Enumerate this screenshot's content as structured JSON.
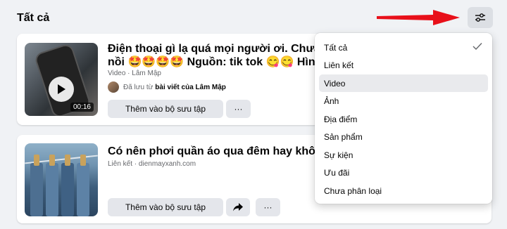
{
  "header": {
    "title": "Tất cả"
  },
  "filter": {
    "icon": "sliders-icon"
  },
  "items": [
    {
      "title_line1": "Điện thoại gì lạ quá mọi người ơi. Chưa thấy",
      "title_line2": "nồi 🤩🤩🤩🤩 Nguồn: tik tok 😋😋 Hình",
      "meta": "Video · Lâm Mập",
      "saved_prefix": "Đã lưu từ",
      "saved_link": "bài viết của Lâm Mập",
      "duration": "00:16",
      "collection_label": "Thêm vào bộ sưu tập",
      "more_label": "···"
    },
    {
      "title_line1": "Có nên phơi quần áo qua đêm hay không?",
      "meta": "Liên kết · dienmayxanh.com",
      "collection_label": "Thêm vào bộ sưu tập",
      "more_label": "···"
    }
  ],
  "dropdown": {
    "options": [
      "Tất cả",
      "Liên kết",
      "Video",
      "Ảnh",
      "Địa điểm",
      "Sản phẩm",
      "Sự kiện",
      "Ưu đãi",
      "Chưa phân loại"
    ],
    "checked": "Tất cả",
    "highlighted": "Video"
  },
  "colors": {
    "arrow": "#e8101a",
    "button_bg": "#e4e6eb",
    "page_bg": "#f0f2f5"
  }
}
